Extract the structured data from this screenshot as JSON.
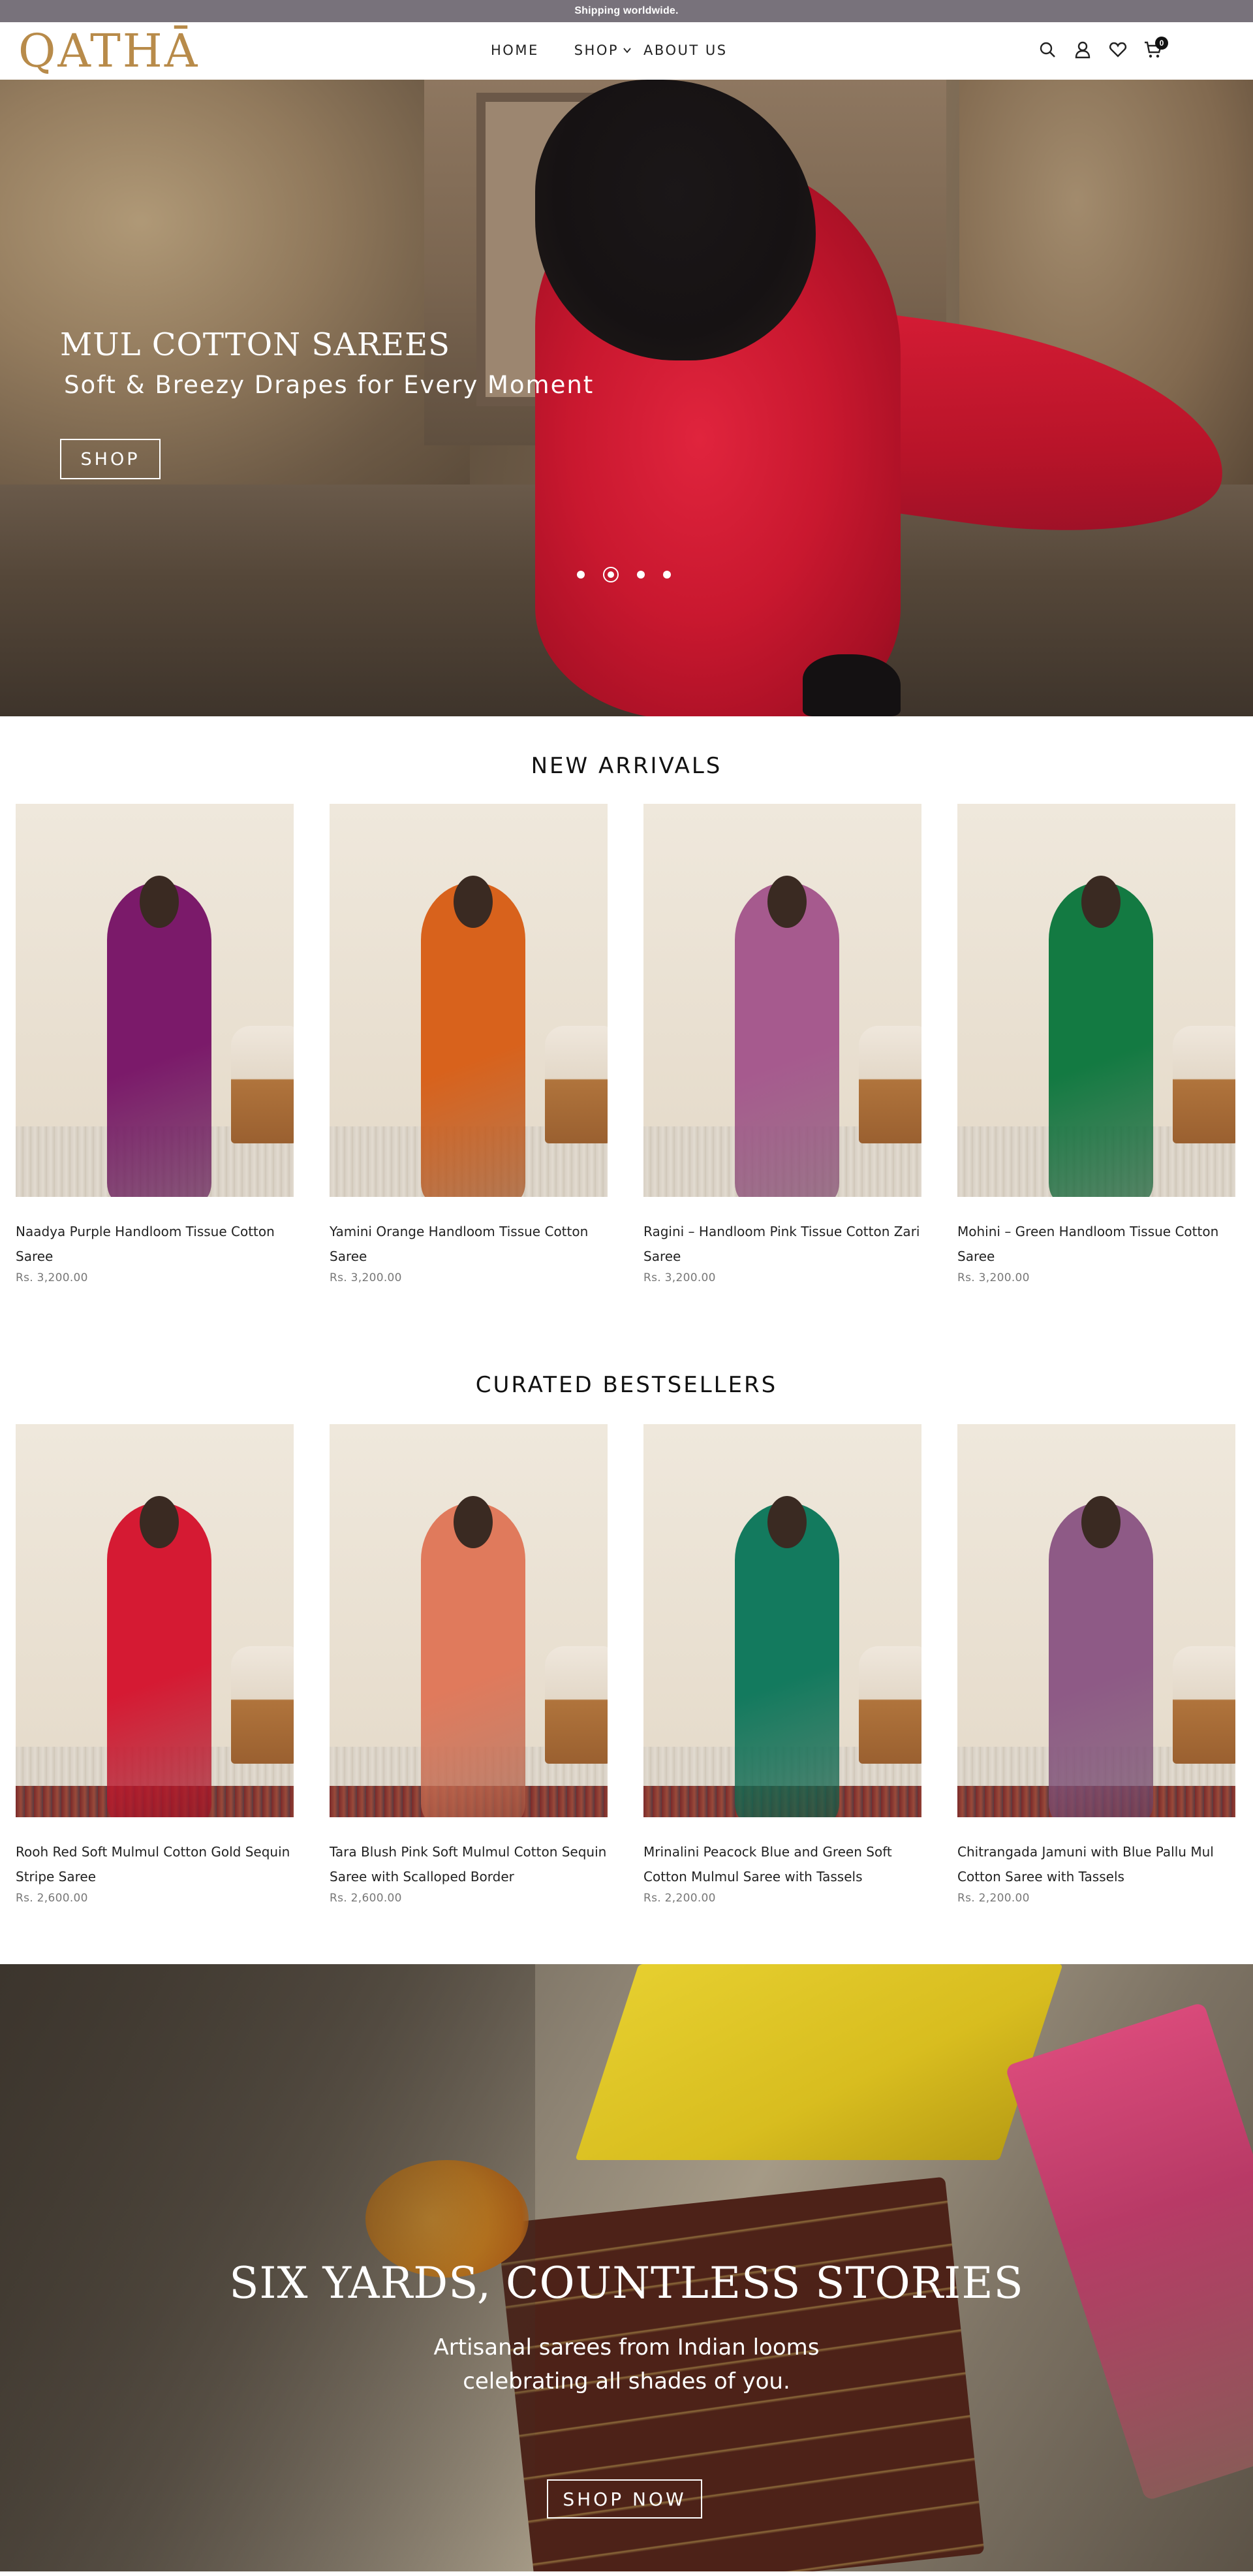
{
  "announcement": "Shipping worldwide.",
  "header": {
    "logo": "QATHĀ",
    "nav": {
      "home": "HOME",
      "shop": "SHOP",
      "about": "ABOUT US"
    },
    "cart_count": "0",
    "icons": [
      "search-icon",
      "user-icon",
      "heart-icon",
      "cart-icon"
    ]
  },
  "hero": {
    "title": "MUL COTTON SAREES",
    "subtitle": "Soft & Breezy Drapes for Every Moment",
    "button": "SHOP",
    "slides": 4,
    "active_slide": 2
  },
  "new_arrivals": {
    "title": "NEW ARRIVALS",
    "products": [
      {
        "name": "Naadya Purple Handloom Tissue Cotton Saree",
        "price": "Rs. 3,200.00",
        "saree_color": "#7b1a6a"
      },
      {
        "name": "Yamini Orange Handloom Tissue Cotton Saree",
        "price": "Rs. 3,200.00",
        "saree_color": "#d8621c"
      },
      {
        "name": "Ragini – Handloom Pink Tissue Cotton Zari Saree",
        "price": "Rs. 3,200.00",
        "saree_color": "#a65a8e"
      },
      {
        "name": "Mohini – Green Handloom Tissue Cotton Saree",
        "price": "Rs. 3,200.00",
        "saree_color": "#137a42"
      }
    ]
  },
  "bestsellers": {
    "title": "CURATED BESTSELLERS",
    "products": [
      {
        "name": "Rooh Red Soft Mulmul Cotton Gold Sequin Stripe Saree",
        "price": "Rs. 2,600.00",
        "saree_color": "#d51a33"
      },
      {
        "name": "Tara Blush Pink Soft Mulmul Cotton Sequin Saree with Scalloped Border",
        "price": "Rs. 2,600.00",
        "saree_color": "#e07a5c"
      },
      {
        "name": "Mrinalini Peacock Blue and Green Soft Cotton Mulmul Saree with Tassels",
        "price": "Rs. 2,200.00",
        "saree_color": "#137a5e"
      },
      {
        "name": "Chitrangada Jamuni with Blue Pallu Mul Cotton Saree with Tassels",
        "price": "Rs. 2,200.00",
        "saree_color": "#8e5a86"
      }
    ]
  },
  "banner": {
    "title": "SIX YARDS, COUNTLESS STORIES",
    "line1": "Artisanal sarees from Indian looms",
    "line2": "celebrating all shades of you.",
    "button": "SHOP NOW"
  },
  "colors": {
    "announcement_bg": "#78727b",
    "logo": "#b88b4a",
    "hero_saree": "#c9182f"
  }
}
